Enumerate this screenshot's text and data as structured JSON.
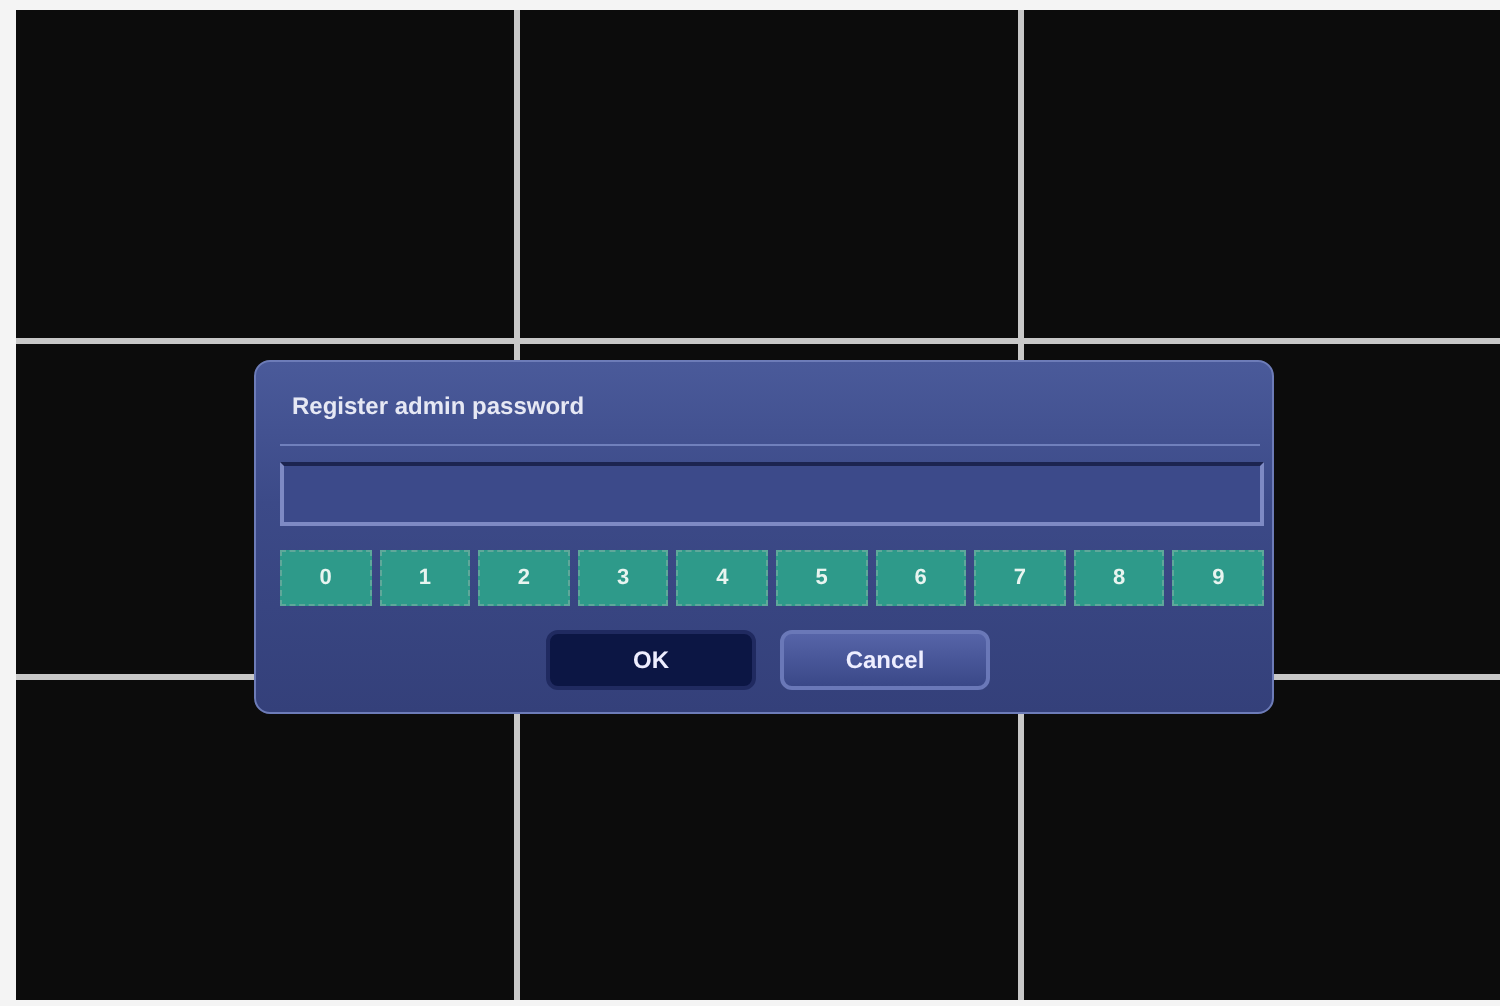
{
  "camera_grid": {
    "tiles": [
      {
        "kind": "empty"
      },
      {
        "kind": "empty"
      },
      {
        "kind": "empty"
      },
      {
        "kind": "empty"
      },
      {
        "kind": "empty"
      },
      {
        "kind": "empty"
      },
      {
        "kind": "empty"
      },
      {
        "kind": "empty"
      },
      {
        "kind": "empty"
      }
    ]
  },
  "dialog": {
    "title": "Register admin password",
    "keypad": [
      "0",
      "1",
      "2",
      "3",
      "4",
      "5",
      "6",
      "7",
      "8",
      "9"
    ],
    "buttons": [
      {
        "label": "OK",
        "selected": true
      },
      {
        "label": "Cancel",
        "selected": false
      }
    ]
  }
}
